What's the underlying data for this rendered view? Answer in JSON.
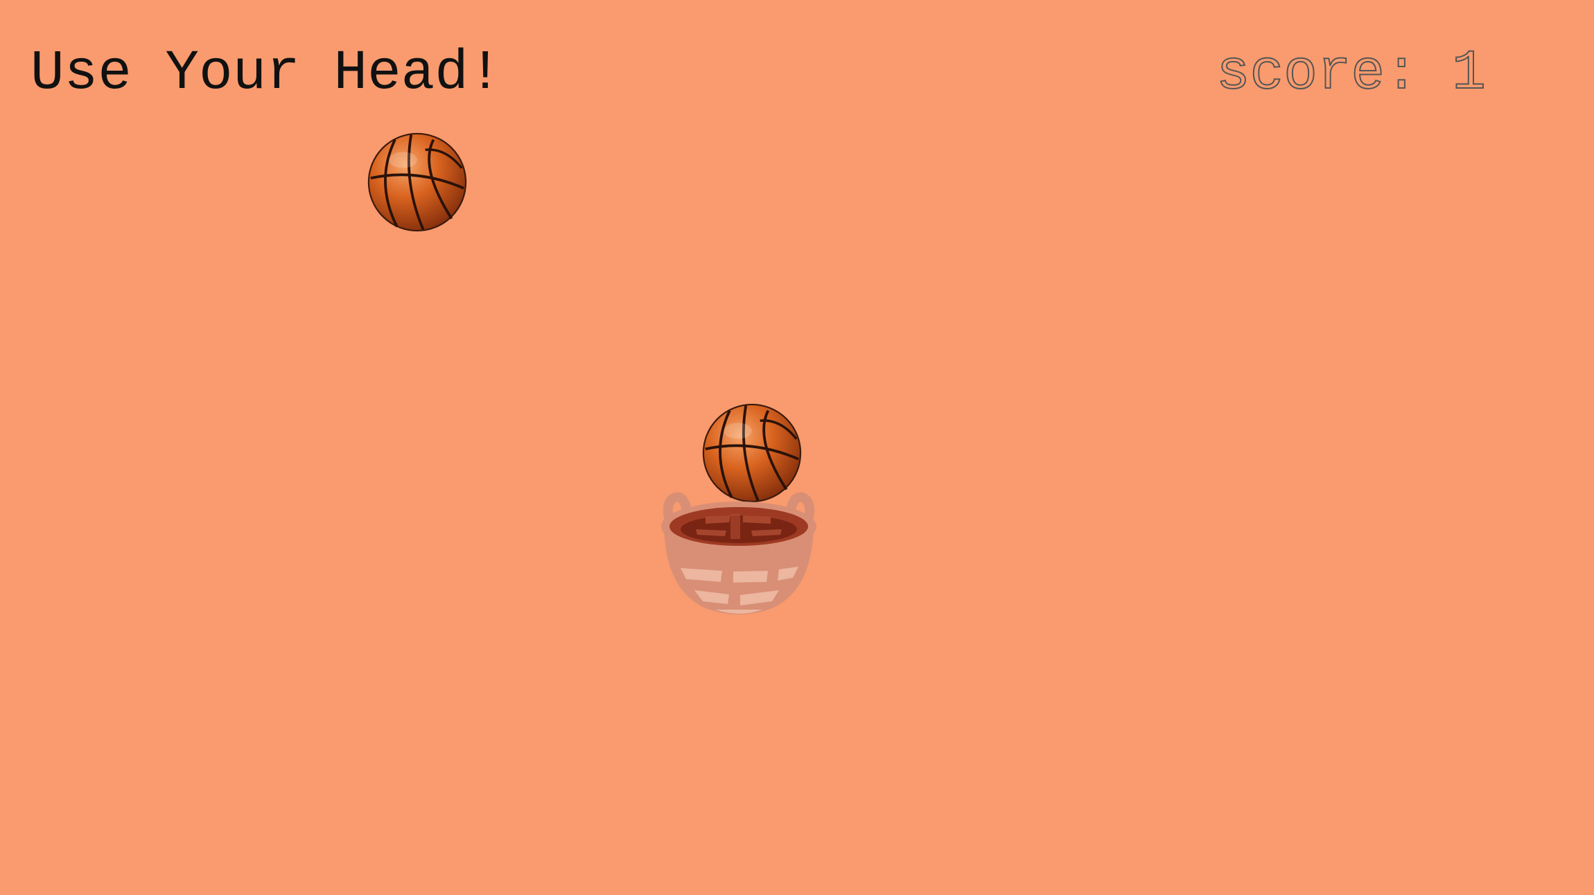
{
  "game": {
    "title": "Use Your Head!",
    "score_label": "score:",
    "score_value": "1"
  },
  "colors": {
    "background": "#f99b6e",
    "title_text": "#111111",
    "score_outline": "#555555",
    "ball": "#d2571b",
    "basket": "#d88f76"
  },
  "sprites": {
    "falling_ball": "basketball-icon",
    "held_ball": "basketball-icon",
    "player": "basket-icon"
  }
}
